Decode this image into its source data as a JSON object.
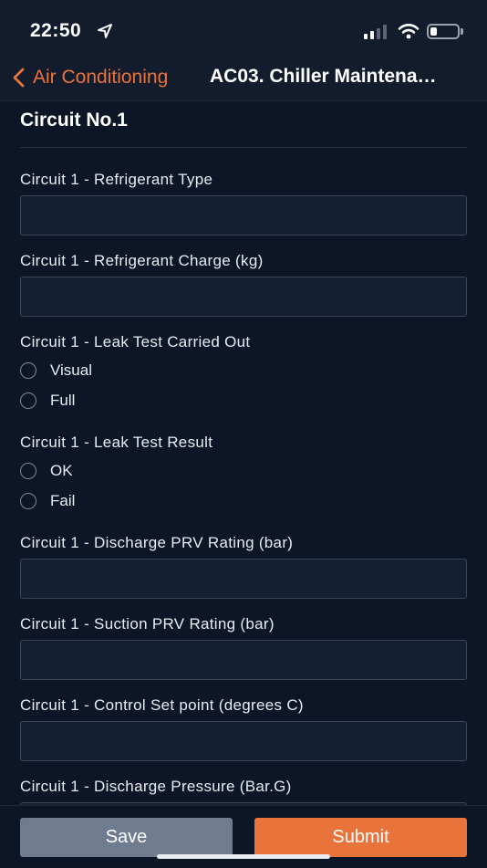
{
  "status_bar": {
    "time": "22:50"
  },
  "nav": {
    "back_label": "Air Conditioning",
    "title": "AC03. Chiller Maintena…"
  },
  "form": {
    "section_title": "Circuit No.1",
    "refrigerant_type": {
      "label": "Circuit 1 - Refrigerant Type",
      "value": ""
    },
    "refrigerant_charge": {
      "label": "Circuit 1 - Refrigerant Charge (kg)",
      "value": ""
    },
    "leak_test_carried_out": {
      "label": "Circuit 1 - Leak Test Carried Out",
      "options": [
        "Visual",
        "Full"
      ]
    },
    "leak_test_result": {
      "label": "Circuit 1 - Leak Test Result",
      "options": [
        "OK",
        "Fail"
      ]
    },
    "discharge_prv": {
      "label": "Circuit 1 - Discharge PRV Rating (bar)",
      "value": ""
    },
    "suction_prv": {
      "label": "Circuit 1 - Suction PRV Rating (bar)",
      "value": ""
    },
    "control_set_point": {
      "label": "Circuit 1 - Control Set point (degrees C)",
      "value": ""
    },
    "discharge_pressure": {
      "label": "Circuit 1 - Discharge Pressure (Bar.G)",
      "value": ""
    }
  },
  "actions": {
    "save_label": "Save",
    "submit_label": "Submit"
  },
  "colors": {
    "accent": "#e8743b",
    "background": "#0d1626",
    "save_button": "#6f7b8e"
  }
}
